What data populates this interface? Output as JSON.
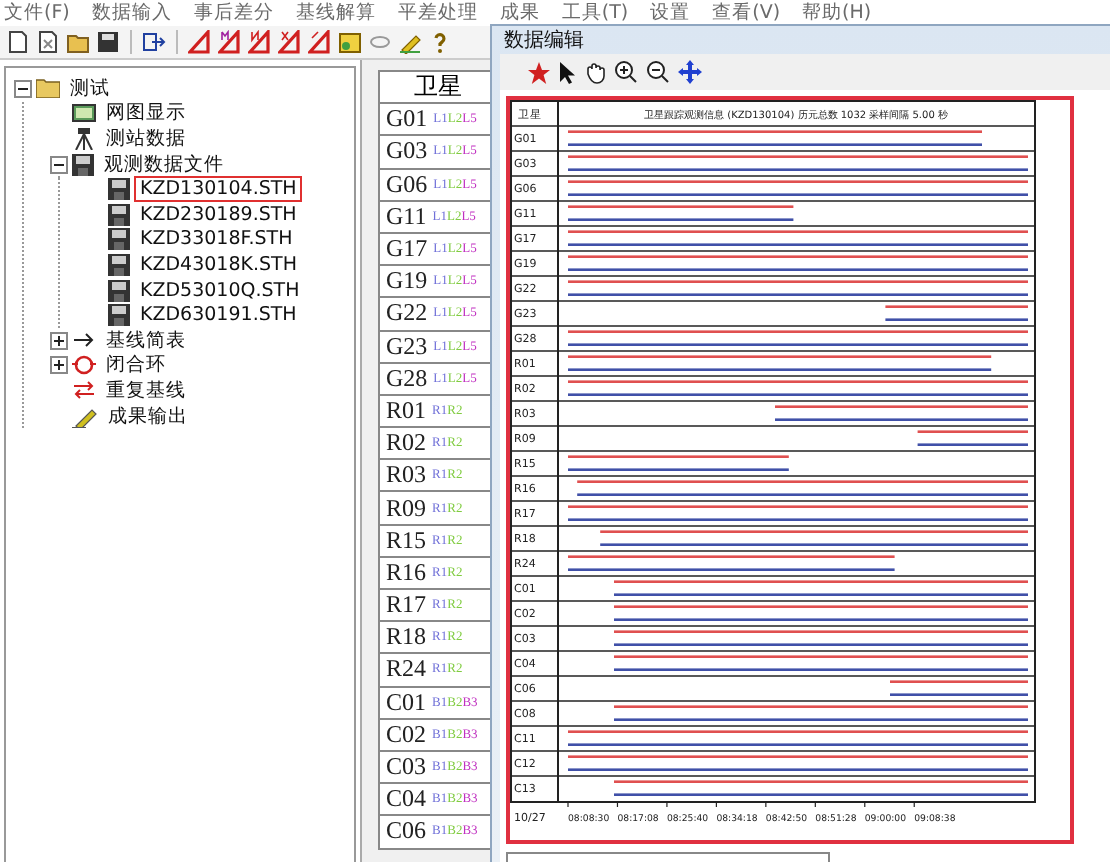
{
  "menu": [
    "文件(F)",
    "数据输入",
    "事后差分",
    "基线解算",
    "平差处理",
    "成果",
    "工具(T)",
    "设置",
    "查看(V)",
    "帮助(H)"
  ],
  "tree": {
    "label": "测试",
    "kind": "folder",
    "expanded": true,
    "selected": false,
    "children": [
      {
        "label": "网图显示",
        "kind": "map",
        "selected": false
      },
      {
        "label": "测站数据",
        "kind": "station",
        "selected": false
      },
      {
        "label": "观测数据文件",
        "kind": "disk",
        "expanded": true,
        "selected": false,
        "children": [
          {
            "label": "KZD130104.STH",
            "kind": "disk",
            "selected": true
          },
          {
            "label": "KZD230189.STH",
            "kind": "disk",
            "selected": false
          },
          {
            "label": "KZD33018F.STH",
            "kind": "disk",
            "selected": false
          },
          {
            "label": "KZD43018K.STH",
            "kind": "disk",
            "selected": false
          },
          {
            "label": "KZD53010Q.STH",
            "kind": "disk",
            "selected": false
          },
          {
            "label": "KZD630191.STH",
            "kind": "disk",
            "selected": false
          }
        ]
      },
      {
        "label": "基线简表",
        "kind": "arrow",
        "expanded": false,
        "selected": false
      },
      {
        "label": "闭合环",
        "kind": "loop",
        "expanded": false,
        "selected": false
      },
      {
        "label": "重复基线",
        "kind": "repeat",
        "selected": false
      },
      {
        "label": "成果输出",
        "kind": "pen",
        "selected": false
      }
    ]
  },
  "satellite_list": {
    "header": "卫星",
    "rows": [
      {
        "name": "G01",
        "bands": [
          {
            "label": "L1",
            "color": "#7070d8"
          },
          {
            "label": "L2",
            "color": "#80cc40"
          },
          {
            "label": "L5",
            "color": "#c030c0"
          }
        ]
      },
      {
        "name": "G03",
        "bands": [
          {
            "label": "L1",
            "color": "#7070d8"
          },
          {
            "label": "L2",
            "color": "#80cc40"
          },
          {
            "label": "L5",
            "color": "#c030c0"
          }
        ]
      },
      {
        "name": "G06",
        "bands": [
          {
            "label": "L1",
            "color": "#7070d8"
          },
          {
            "label": "L2",
            "color": "#80cc40"
          },
          {
            "label": "L5",
            "color": "#c030c0"
          }
        ]
      },
      {
        "name": "G11",
        "bands": [
          {
            "label": "L1",
            "color": "#7070d8"
          },
          {
            "label": "L2",
            "color": "#80cc40"
          },
          {
            "label": "L5",
            "color": "#c030c0"
          }
        ]
      },
      {
        "name": "G17",
        "bands": [
          {
            "label": "L1",
            "color": "#7070d8"
          },
          {
            "label": "L2",
            "color": "#80cc40"
          },
          {
            "label": "L5",
            "color": "#c030c0"
          }
        ]
      },
      {
        "name": "G19",
        "bands": [
          {
            "label": "L1",
            "color": "#7070d8"
          },
          {
            "label": "L2",
            "color": "#80cc40"
          },
          {
            "label": "L5",
            "color": "#c030c0"
          }
        ]
      },
      {
        "name": "G22",
        "bands": [
          {
            "label": "L1",
            "color": "#7070d8"
          },
          {
            "label": "L2",
            "color": "#80cc40"
          },
          {
            "label": "L5",
            "color": "#c030c0"
          }
        ]
      },
      {
        "name": "G23",
        "bands": [
          {
            "label": "L1",
            "color": "#7070d8"
          },
          {
            "label": "L2",
            "color": "#80cc40"
          },
          {
            "label": "L5",
            "color": "#c030c0"
          }
        ]
      },
      {
        "name": "G28",
        "bands": [
          {
            "label": "L1",
            "color": "#7070d8"
          },
          {
            "label": "L2",
            "color": "#80cc40"
          },
          {
            "label": "L5",
            "color": "#c030c0"
          }
        ]
      },
      {
        "name": "R01",
        "bands": [
          {
            "label": "R1",
            "color": "#7070d8"
          },
          {
            "label": "R2",
            "color": "#80cc40"
          }
        ]
      },
      {
        "name": "R02",
        "bands": [
          {
            "label": "R1",
            "color": "#7070d8"
          },
          {
            "label": "R2",
            "color": "#80cc40"
          }
        ]
      },
      {
        "name": "R03",
        "bands": [
          {
            "label": "R1",
            "color": "#7070d8"
          },
          {
            "label": "R2",
            "color": "#80cc40"
          }
        ]
      },
      {
        "name": "R09",
        "bands": [
          {
            "label": "R1",
            "color": "#7070d8"
          },
          {
            "label": "R2",
            "color": "#80cc40"
          }
        ]
      },
      {
        "name": "R15",
        "bands": [
          {
            "label": "R1",
            "color": "#7070d8"
          },
          {
            "label": "R2",
            "color": "#80cc40"
          }
        ]
      },
      {
        "name": "R16",
        "bands": [
          {
            "label": "R1",
            "color": "#7070d8"
          },
          {
            "label": "R2",
            "color": "#80cc40"
          }
        ]
      },
      {
        "name": "R17",
        "bands": [
          {
            "label": "R1",
            "color": "#7070d8"
          },
          {
            "label": "R2",
            "color": "#80cc40"
          }
        ]
      },
      {
        "name": "R18",
        "bands": [
          {
            "label": "R1",
            "color": "#7070d8"
          },
          {
            "label": "R2",
            "color": "#80cc40"
          }
        ]
      },
      {
        "name": "R24",
        "bands": [
          {
            "label": "R1",
            "color": "#7070d8"
          },
          {
            "label": "R2",
            "color": "#80cc40"
          }
        ]
      },
      {
        "name": "C01",
        "bands": [
          {
            "label": "B1",
            "color": "#7070d8"
          },
          {
            "label": "B2",
            "color": "#80cc40"
          },
          {
            "label": "B3",
            "color": "#c030c0"
          }
        ]
      },
      {
        "name": "C02",
        "bands": [
          {
            "label": "B1",
            "color": "#7070d8"
          },
          {
            "label": "B2",
            "color": "#80cc40"
          },
          {
            "label": "B3",
            "color": "#c030c0"
          }
        ]
      },
      {
        "name": "C03",
        "bands": [
          {
            "label": "B1",
            "color": "#7070d8"
          },
          {
            "label": "B2",
            "color": "#80cc40"
          },
          {
            "label": "B3",
            "color": "#c030c0"
          }
        ]
      },
      {
        "name": "C04",
        "bands": [
          {
            "label": "B1",
            "color": "#7070d8"
          },
          {
            "label": "B2",
            "color": "#80cc40"
          },
          {
            "label": "B3",
            "color": "#c030c0"
          }
        ]
      },
      {
        "name": "C06",
        "bands": [
          {
            "label": "B1",
            "color": "#7070d8"
          },
          {
            "label": "B2",
            "color": "#80cc40"
          },
          {
            "label": "B3",
            "color": "#c030c0"
          }
        ]
      }
    ]
  },
  "dialog": {
    "title": "数据编辑",
    "chart": {
      "label_header": "卫星",
      "title": "卫星跟踪观测信息 (KZD130104) 历元总数 1032 采样间隔 5.00 秒",
      "date": "10/27",
      "time_axis": [
        "08:08:30",
        "08:17:08",
        "08:25:40",
        "08:34:18",
        "08:42:50",
        "08:51:28",
        "09:00:00",
        "09:08:38"
      ],
      "tracks": [
        {
          "satellite": "G01",
          "kind": "from_start",
          "level": 0.9
        },
        {
          "satellite": "G03",
          "kind": "from_start",
          "level": 1
        },
        {
          "satellite": "G06",
          "kind": "from_start",
          "level": 1
        },
        {
          "satellite": "G11",
          "kind": "from_start",
          "level": 0.49
        },
        {
          "satellite": "G17",
          "kind": "from_start",
          "level": 1
        },
        {
          "satellite": "G19",
          "kind": "from_start",
          "level": 1
        },
        {
          "satellite": "G22",
          "kind": "from_start",
          "level": 1
        },
        {
          "satellite": "G23",
          "kind": "to_end",
          "level": 0.31
        },
        {
          "satellite": "G28",
          "kind": "from_start",
          "level": 1
        },
        {
          "satellite": "R01",
          "kind": "from_start",
          "level": 0.92
        },
        {
          "satellite": "R02",
          "kind": "from_start",
          "level": 1
        },
        {
          "satellite": "R03",
          "kind": "to_end",
          "level": 0.55
        },
        {
          "satellite": "R09",
          "kind": "to_end",
          "level": 0.24
        },
        {
          "satellite": "R15",
          "kind": "from_start",
          "level": 0.48
        },
        {
          "satellite": "R16",
          "kind": "to_end",
          "level": 0.98
        },
        {
          "satellite": "R17",
          "kind": "from_start",
          "level": 1
        },
        {
          "satellite": "R18",
          "kind": "to_end",
          "level": 0.93
        },
        {
          "satellite": "R24",
          "kind": "from_start",
          "level": 0.71
        },
        {
          "satellite": "C01",
          "kind": "to_end",
          "level": 0.9
        },
        {
          "satellite": "C02",
          "kind": "to_end",
          "level": 0.9
        },
        {
          "satellite": "C03",
          "kind": "to_end",
          "level": 0.9
        },
        {
          "satellite": "C04",
          "kind": "to_end",
          "level": 0.9
        },
        {
          "satellite": "C06",
          "kind": "to_end",
          "level": 0.3
        },
        {
          "satellite": "C08",
          "kind": "to_end",
          "level": 0.9
        },
        {
          "satellite": "C11",
          "kind": "from_start",
          "level": 1
        },
        {
          "satellite": "C12",
          "kind": "from_start",
          "level": 1
        },
        {
          "satellite": "C13",
          "kind": "to_end",
          "level": 0.9
        }
      ]
    }
  }
}
